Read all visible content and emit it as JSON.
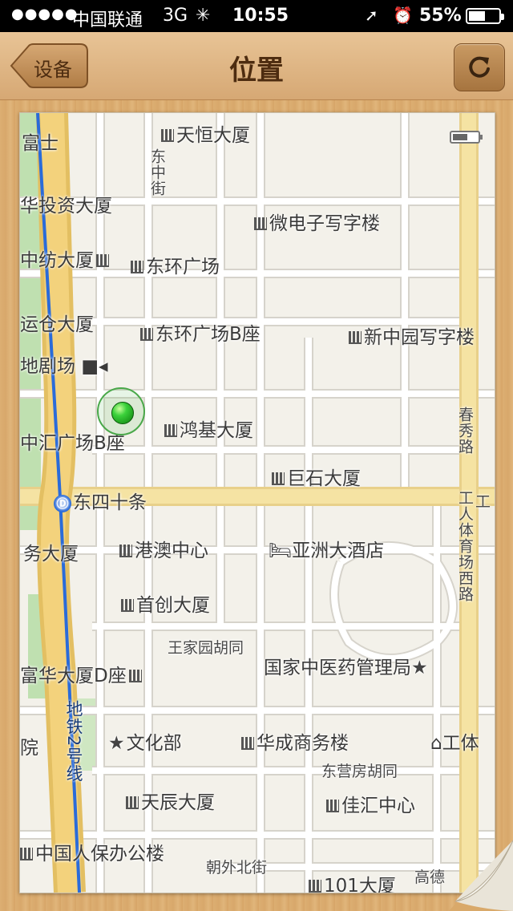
{
  "status_bar": {
    "signal": "●●●●●",
    "carrier": "中国联通",
    "network": "3G",
    "time": "10:55",
    "battery_percent": "55%",
    "battery_level": 0.55
  },
  "nav": {
    "back_label": "设备",
    "title": "位置",
    "refresh_icon": "refresh-icon"
  },
  "map": {
    "device_battery_level": 0.6,
    "labels": {
      "l1": "天恒大厦",
      "l2": "富士",
      "l3": "东中街",
      "l4": "华投资大厦",
      "l5": "微电子写字楼",
      "l6": "中纺大厦",
      "l7": "东环广场",
      "l8": "运仓大厦",
      "l9": "东环广场B座",
      "l10": "新中园写字楼",
      "l11": "地剧场",
      "l12": "鸿基大厦",
      "l13": "中汇广场B座",
      "l14": "春秀路",
      "l15": "巨石大厦",
      "l16": "东四十条",
      "l17": "工人体育场西路",
      "l18": "港澳中心",
      "l19": "亚洲大酒店",
      "l20": "务大厦",
      "l21": "首创大厦",
      "l22": "王家园胡同",
      "l23": "国家中医药管理局",
      "l24": "富华大厦D座",
      "l25": "地铁2号线",
      "l26": "文化部",
      "l27": "华成商务楼",
      "l28": "工体",
      "l29": "东营房胡同",
      "l30": "天辰大厦",
      "l31": "佳汇中心",
      "l32": "中国人保办公楼",
      "l33": "朝外北街",
      "l34": "101大厦",
      "l35": "高德",
      "l36": "院",
      "l37": "工"
    }
  }
}
